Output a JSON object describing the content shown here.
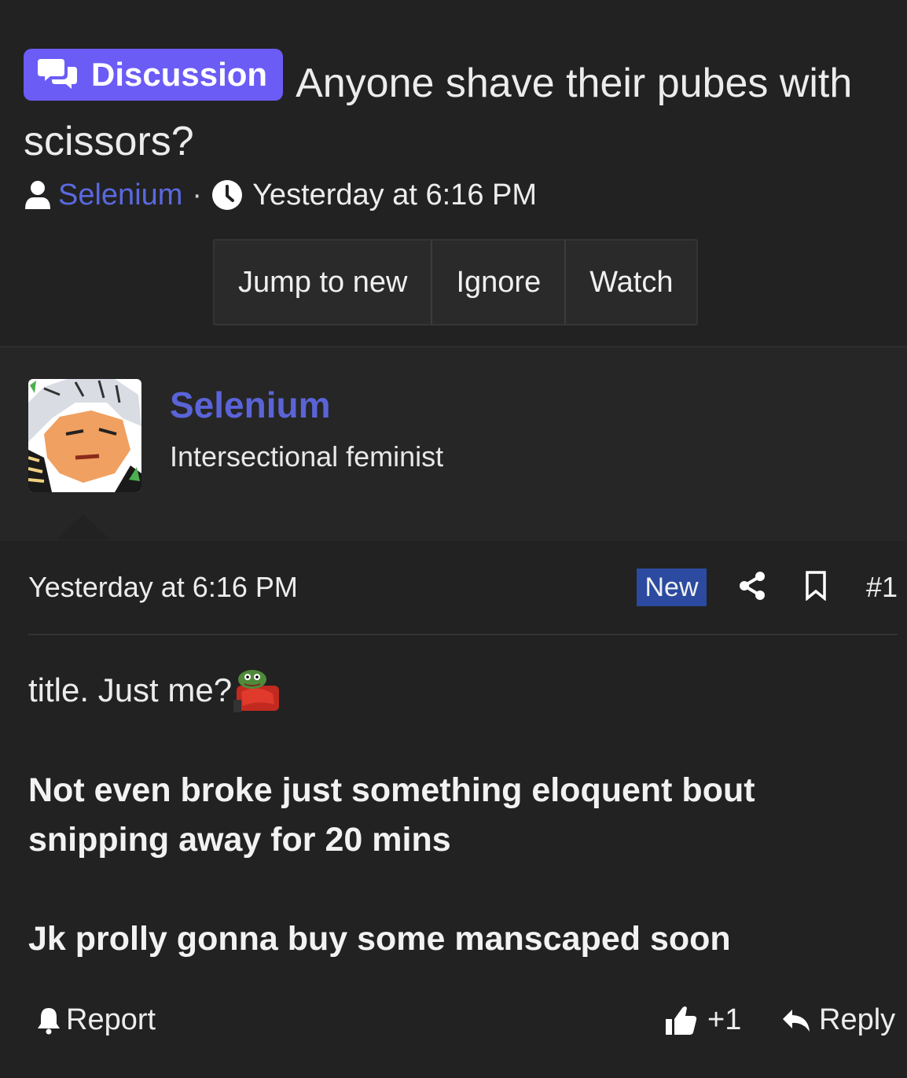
{
  "thread": {
    "prefix_label": "Discussion",
    "title": "Anyone shave their pubes with scissors?",
    "author": "Selenium",
    "separator": "·",
    "timestamp": "Yesterday at 6:16 PM"
  },
  "actions": {
    "jump_label": "Jump to new",
    "ignore_label": "Ignore",
    "watch_label": "Watch"
  },
  "author_block": {
    "name": "Selenium",
    "user_title": "Intersectional feminist"
  },
  "post": {
    "timestamp": "Yesterday at 6:16 PM",
    "new_label": "New",
    "number": "#1",
    "line1": "title. Just me?",
    "line2": "Not even broke just something eloquent bout snipping away for 20 mins",
    "line3": "Jk prolly gonna buy some manscaped soon"
  },
  "footer": {
    "report_label": "Report",
    "like_label": "+1",
    "reply_label": "Reply"
  },
  "colors": {
    "background": "#222222",
    "badge": "#6b5cf6",
    "link": "#5a64d8",
    "new_badge": "#2b4aa0"
  },
  "icons": [
    "comments-icon",
    "user-icon",
    "clock-icon",
    "share-icon",
    "bookmark-icon",
    "bell-icon",
    "thumbs-up-icon",
    "reply-icon",
    "pepe-emoji"
  ]
}
